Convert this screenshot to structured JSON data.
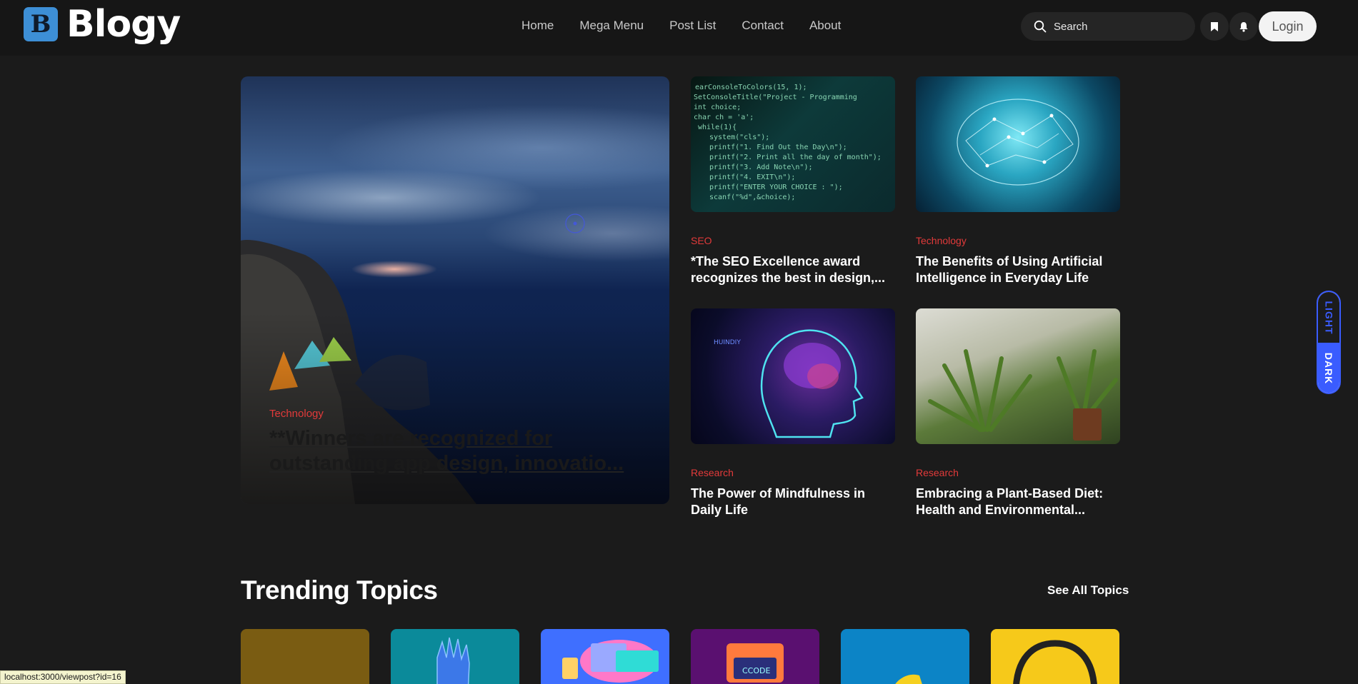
{
  "brand": {
    "logo_letter": "B",
    "name": "Blogy"
  },
  "nav": {
    "items": [
      "Home",
      "Mega Menu",
      "Post List",
      "Contact",
      "About"
    ]
  },
  "search": {
    "placeholder": "Search"
  },
  "header_actions": {
    "login": "Login"
  },
  "hero": {
    "category": "Technology",
    "title": "**Winners are recognized for outstanding app design, innovatio..."
  },
  "posts": [
    {
      "category": "SEO",
      "title": "*The SEO Excellence award recognizes the best in design,..."
    },
    {
      "category": "Technology",
      "title": "The Benefits of Using Artificial Intelligence in Everyday Life"
    },
    {
      "category": "Research",
      "title": "The Power of Mindfulness in Daily Life"
    },
    {
      "category": "Research",
      "title": "Embracing a Plant-Based Diet: Health and Environmental..."
    }
  ],
  "theme_toggle": {
    "light": "LIGHT",
    "dark": "DARK",
    "active": "dark"
  },
  "trending": {
    "title": "Trending Topics",
    "see_all": "See All Topics"
  },
  "topics": [
    {
      "color": "#7a5c12"
    },
    {
      "color": "#0b8a9a"
    },
    {
      "color": "#3f6fff"
    },
    {
      "color": "#5a1070"
    },
    {
      "color": "#0c84c6"
    },
    {
      "color": "#f6c91a"
    }
  ],
  "status_bar": {
    "url": "localhost:3000/viewpost?id=16"
  },
  "colors": {
    "accent": "#e23a3a",
    "toggle": "#3a5cff",
    "background": "#1b1b1b"
  }
}
